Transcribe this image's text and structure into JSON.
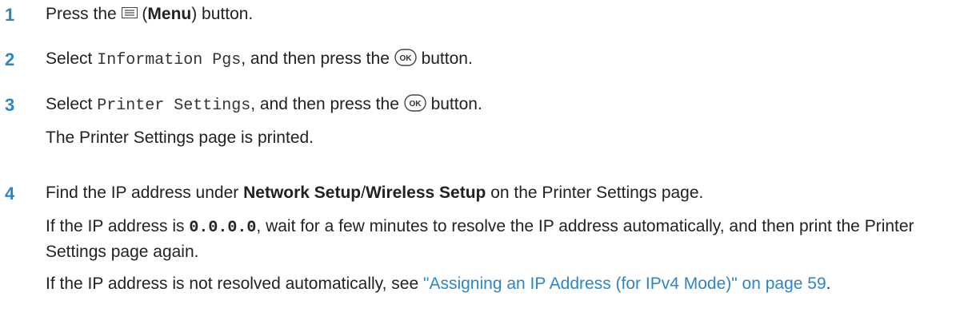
{
  "steps": [
    {
      "num": "1",
      "pre": "Press the",
      "label": "Menu",
      "post": "button."
    },
    {
      "num": "2",
      "pre": "Select",
      "mono": "Information Pgs",
      "mid": ", and then press the",
      "ok": "OK",
      "post": "button."
    },
    {
      "num": "3",
      "pre": "Select",
      "mono": "Printer Settings",
      "mid": ", and then press the",
      "ok": "OK",
      "post": "button.",
      "note": "The Printer Settings page is printed."
    },
    {
      "num": "4",
      "pre": "Find the IP address under",
      "b1": "Network Setup",
      "slash": "/",
      "b2": "Wireless Setup",
      "post": "on the Printer Settings page.",
      "p1a": "If the IP address is",
      "p1ip": "0.0.0.0",
      "p1b": ", wait for a few minutes to resolve the IP address automatically, and then print the Printer Settings page again.",
      "p2": "If the IP address is not resolved automatically, see",
      "link": "\"Assigning an IP Address (for IPv4 Mode)\" on page 59",
      "p2end": "."
    }
  ],
  "colors": {
    "accent": "#2a86c8",
    "text": "#222222"
  },
  "icons": {
    "menu": "menu-icon",
    "ok": "ok-button-icon"
  }
}
